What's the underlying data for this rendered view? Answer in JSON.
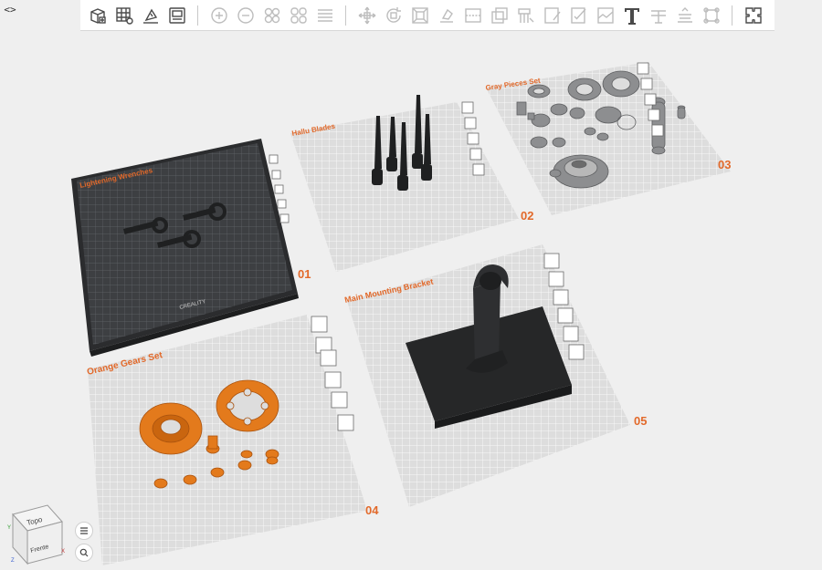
{
  "colors": {
    "accent": "#e2692a",
    "plate_dark": "#3b3d40",
    "plate_light": "#dcdcdc",
    "model_dark": "#1f2021",
    "model_gray": "#8d8e90",
    "model_orange": "#e37a1c"
  },
  "toolbar": {
    "left_icons": [
      "add-plate-icon",
      "arrange-icon",
      "orient-icon",
      "plate-settings-icon"
    ],
    "mid_icons": [
      "zoom-in-icon",
      "zoom-out-icon",
      "split-objects-icon",
      "split-parts-icon",
      "layers-icon"
    ],
    "right_icons": [
      "move-icon",
      "rotate-icon",
      "scale-icon",
      "lay-on-face-icon",
      "cut-icon",
      "mesh-boolean-icon",
      "support-paint-icon",
      "seam-paint-icon",
      "color-paint-icon",
      "measure-icon",
      "text-icon",
      "assembly-icon",
      "variable-layer-icon",
      "fix-model-icon",
      "puzzle-icon"
    ]
  },
  "plates": [
    {
      "id": "01",
      "name": "Lightening Wrenches",
      "number": "01",
      "brand": "CREALITY"
    },
    {
      "id": "02",
      "name": "Hallu Blades",
      "number": "02"
    },
    {
      "id": "03",
      "name": "Gray Pieces Set",
      "number": "03"
    },
    {
      "id": "04",
      "name": "Orange Gears Set",
      "number": "04"
    },
    {
      "id": "05",
      "name": "Main Mounting Bracket",
      "number": "05"
    }
  ],
  "viewcube": {
    "top_label": "Topo",
    "front_label": "Frente",
    "axis_x": "X",
    "axis_y": "Y",
    "axis_z": "Z"
  },
  "collapse_label": "<>"
}
